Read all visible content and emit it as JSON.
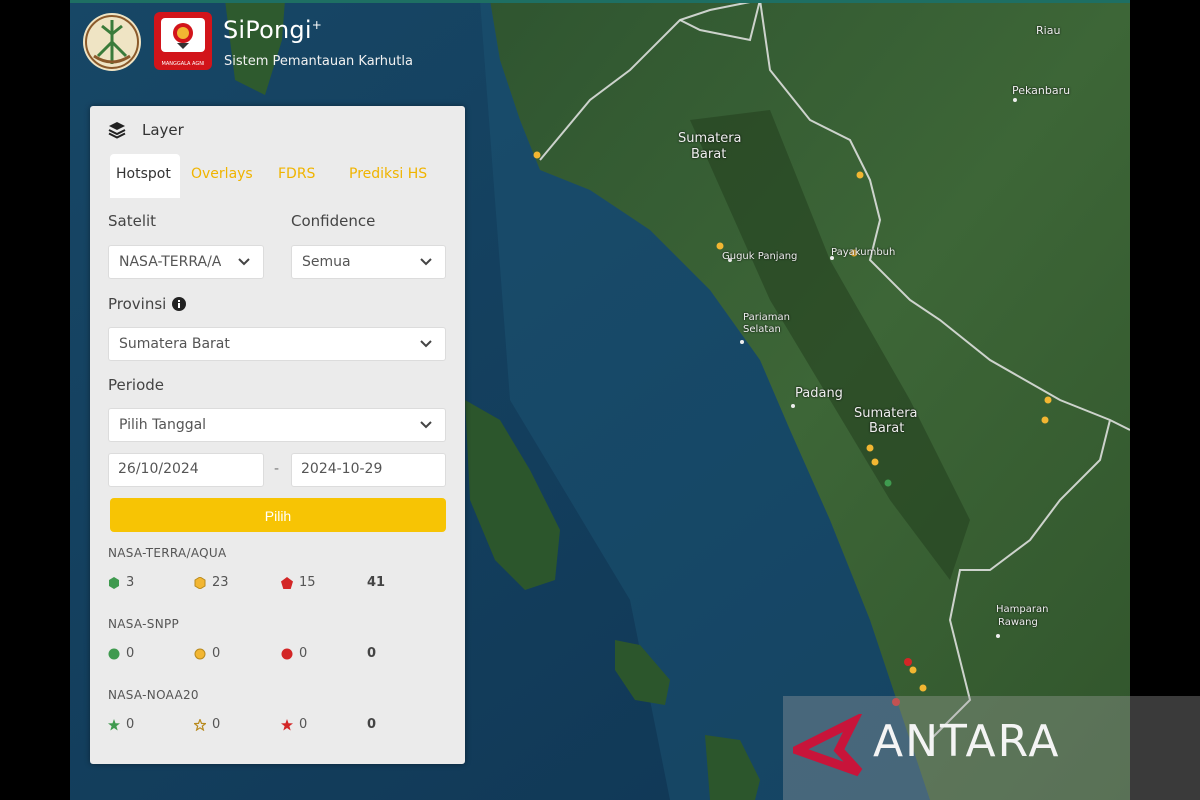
{
  "header": {
    "app_name": "SiPongi",
    "app_sup": "+",
    "subtitle": "Sistem Pemantauan Karhutla",
    "badge_caption": "MANGGALA AGNI"
  },
  "panel": {
    "title": "Layer",
    "tabs": [
      {
        "label": "Hotspot",
        "active": true
      },
      {
        "label": "Overlays",
        "active": false
      },
      {
        "label": "FDRS",
        "active": false
      },
      {
        "label": "Prediksi HS",
        "active": false
      }
    ],
    "satelit_label": "Satelit",
    "satelit_value": "NASA-TERRA/AQUA",
    "confidence_label": "Confidence",
    "confidence_value": "Semua",
    "provinsi_label": "Provinsi",
    "provinsi_value": "Sumatera Barat",
    "periode_label": "Periode",
    "periode_value": "Pilih Tanggal",
    "date_from": "26/10/2024",
    "date_sep": "-",
    "date_to": "2024-10-29",
    "submit_label": "Pilih"
  },
  "summary": [
    {
      "satellite": "NASA-TERRA/AQUA",
      "low": "3",
      "medium": "23",
      "high": "15",
      "total": "41",
      "marker": "hexagon"
    },
    {
      "satellite": "NASA-SNPP",
      "low": "0",
      "medium": "0",
      "high": "0",
      "total": "0",
      "marker": "circle"
    },
    {
      "satellite": "NASA-NOAA20",
      "low": "0",
      "medium": "0",
      "high": "0",
      "total": "0",
      "marker": "star"
    }
  ],
  "colors": {
    "low": "#3f9a4f",
    "medium": "#f2b632",
    "high": "#d32626",
    "accent": "#f7c404"
  },
  "map_labels": {
    "riau": "Riau",
    "pekanbaru": "Pekanbaru",
    "sumbar_north_1": "Sumatera",
    "sumbar_north_2": "Barat",
    "guguk": "Guguk Panjang",
    "payakumbuh": "Payakumbuh",
    "pariaman_1": "Pariaman",
    "pariaman_2": "Selatan",
    "padang": "Padang",
    "sumbar_south_1": "Sumatera",
    "sumbar_south_2": "Barat",
    "hamparan_1": "Hamparan",
    "hamparan_2": "Rawang"
  },
  "watermark": "ANTARA"
}
